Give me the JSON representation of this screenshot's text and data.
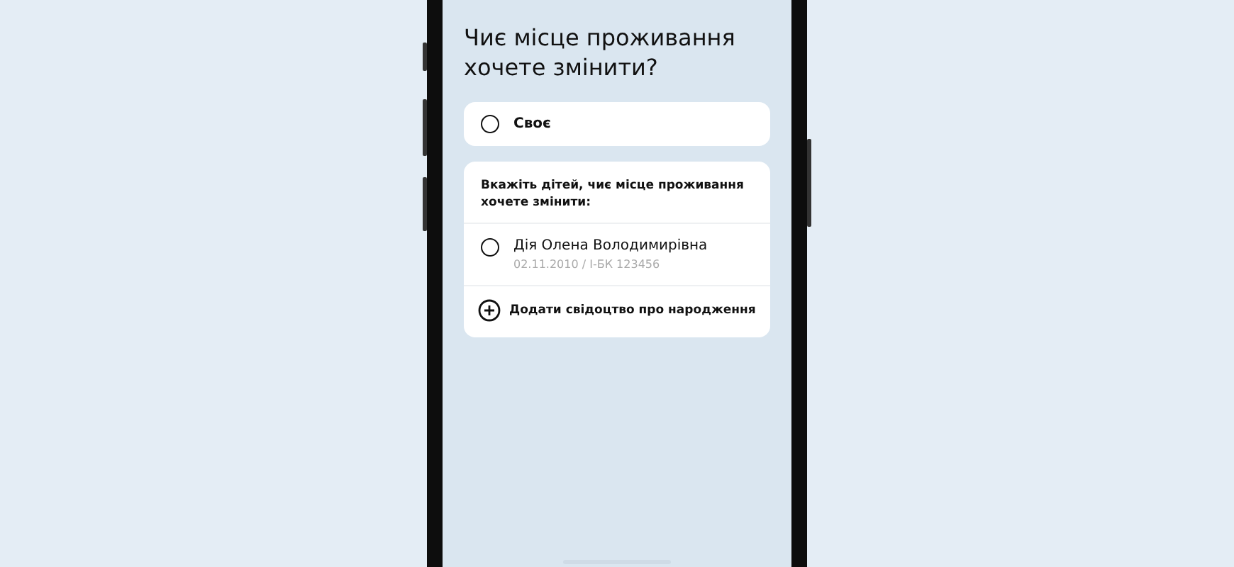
{
  "screen": {
    "title": "Чиє місце проживання хочете змінити?",
    "own_option": {
      "label": "Своє",
      "selected": false
    },
    "children_card": {
      "prompt": "Вкажіть дітей, чиє місце проживання хочете змінити:",
      "children": [
        {
          "name": "Дія Олена Володимирівна",
          "details": "02.11.2010 / І-БК 123456",
          "selected": false
        }
      ],
      "add_button": "Додати свідоцтво про народження"
    }
  }
}
